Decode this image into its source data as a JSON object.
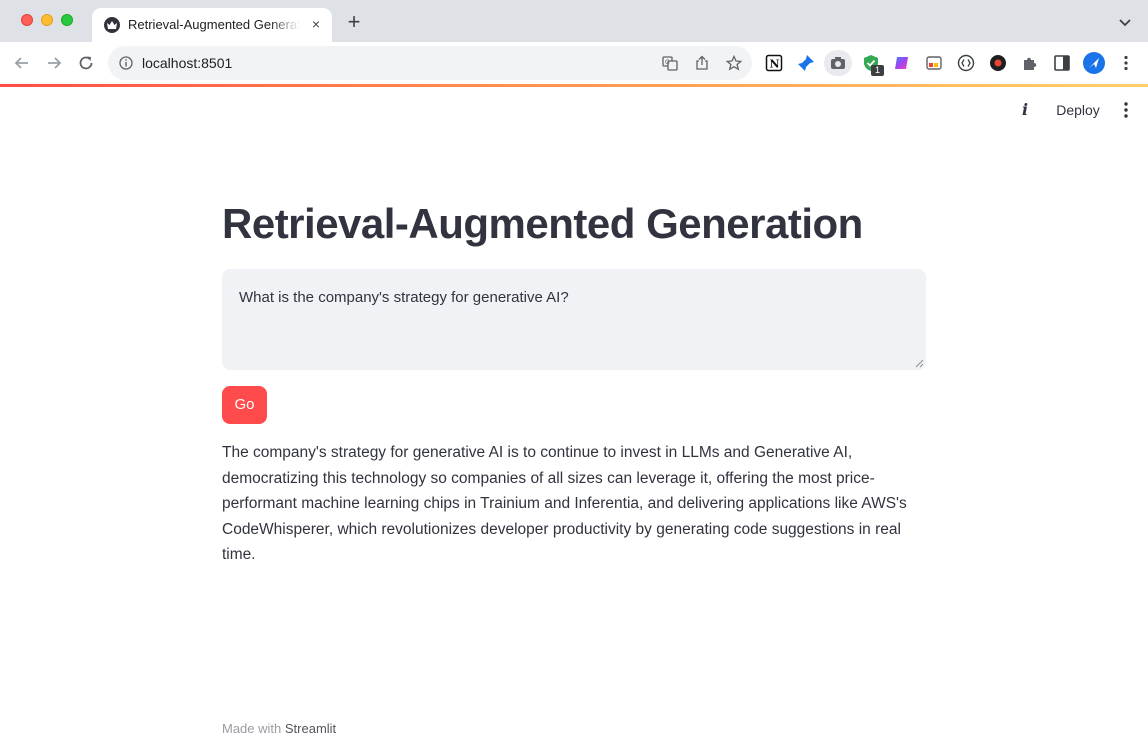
{
  "browser": {
    "tab_title": "Retrieval-Augmented Generation",
    "tab_close": "×",
    "new_tab": "+",
    "url": "localhost:8501",
    "extension_badge": "1"
  },
  "streamlit_header": {
    "info_icon": "i",
    "deploy_label": "Deploy",
    "menu_icon": "kebab-menu-icon"
  },
  "main": {
    "title": "Retrieval-Augmented Generation",
    "query_value": "What is the company's strategy for generative AI?",
    "go_label": "Go",
    "answer": "The company's strategy for generative AI is to continue to invest in LLMs and Generative AI, democratizing this technology so companies of all sizes can leverage it, offering the most price-performant machine learning chips in Trainium and Inferentia, and delivering applications like AWS's CodeWhisperer, which revolutionizes developer productivity by generating code suggestions in real time."
  },
  "footer": {
    "prefix": "Made with",
    "brand": "Streamlit"
  },
  "colors": {
    "primary": "#ff4b4b",
    "text": "#31333f",
    "input_bg": "#f0f2f6",
    "chrome_bg": "#dee1e6"
  }
}
